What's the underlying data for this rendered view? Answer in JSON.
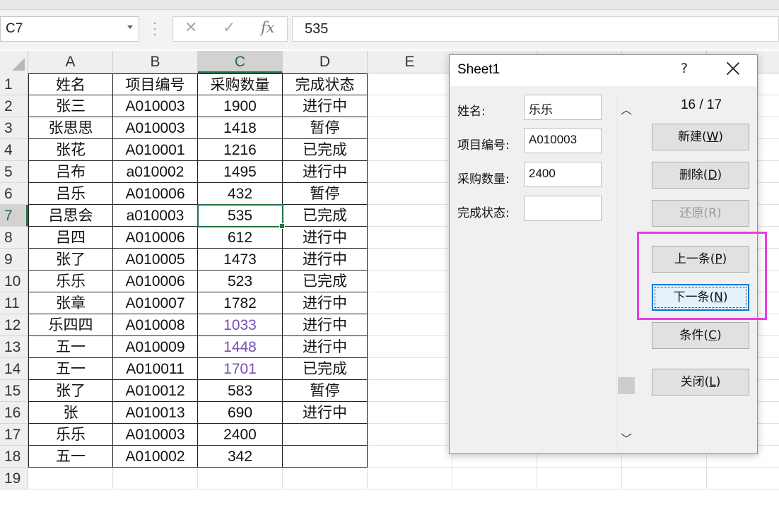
{
  "formula_bar": {
    "name_box": "C7",
    "formula_value": "535",
    "cancel_icon": "close-icon",
    "enter_icon": "check-icon",
    "function_label": "fx"
  },
  "columns": [
    "A",
    "B",
    "C",
    "D",
    "E"
  ],
  "row_numbers": [
    "1",
    "2",
    "3",
    "4",
    "5",
    "6",
    "7",
    "8",
    "9",
    "10",
    "11",
    "12",
    "13",
    "14",
    "15",
    "16",
    "17",
    "18",
    "19"
  ],
  "table": {
    "header": [
      "姓名",
      "项目编号",
      "采购数量",
      "完成状态"
    ],
    "rows": [
      [
        "张三",
        "A010003",
        "1900",
        "进行中"
      ],
      [
        "张思思",
        "A010003",
        "1418",
        "暂停"
      ],
      [
        "张花",
        "A010001",
        "1216",
        "已完成"
      ],
      [
        "吕布",
        "a010002",
        "1495",
        "进行中"
      ],
      [
        "吕乐",
        "A010006",
        "432",
        "暂停"
      ],
      [
        "吕思会",
        "a010003",
        "535",
        "已完成"
      ],
      [
        "吕四",
        "A010006",
        "612",
        "进行中"
      ],
      [
        "张了",
        "A010005",
        "1473",
        "进行中"
      ],
      [
        "乐乐",
        "A010006",
        "523",
        "已完成"
      ],
      [
        "张章",
        "A010007",
        "1782",
        "进行中"
      ],
      [
        "乐四四",
        "A010008",
        "1033",
        "进行中"
      ],
      [
        "五一",
        "A010009",
        "1448",
        "进行中"
      ],
      [
        "五一",
        "A010011",
        "1701",
        "已完成"
      ],
      [
        "张了",
        "A010012",
        "583",
        "暂停"
      ],
      [
        "张",
        "A010013",
        "690",
        "进行中"
      ],
      [
        "乐乐",
        "A010003",
        "2400",
        ""
      ],
      [
        "五一",
        "A010002",
        "342",
        ""
      ]
    ],
    "purple_text_color": "#7a4fb4",
    "active_cell": "C7"
  },
  "dialog": {
    "title": "Sheet1",
    "help": "?",
    "fields": [
      {
        "label": "姓名:",
        "value": "乐乐"
      },
      {
        "label": "项目编号:",
        "value": "A010003"
      },
      {
        "label": "采购数量:",
        "value": "2400"
      },
      {
        "label": "完成状态:",
        "value": ""
      }
    ],
    "record_counter": "16 / 17",
    "buttons": {
      "new": {
        "text": "新建(",
        "key": "W",
        "end": ")"
      },
      "delete": {
        "text": "删除(",
        "key": "D",
        "end": ")"
      },
      "restore": {
        "text": "还原(",
        "key": "R",
        "end": ")"
      },
      "prev": {
        "text": "上一条(",
        "key": "P",
        "end": ")"
      },
      "next": {
        "text": "下一条(",
        "key": "N",
        "end": ")"
      },
      "criteria": {
        "text": "条件(",
        "key": "C",
        "end": ")"
      },
      "close": {
        "text": "关闭(",
        "key": "L",
        "end": ")"
      }
    },
    "scroll_up_icon": "chevron-up-icon",
    "scroll_down_icon": "chevron-down-icon"
  },
  "highlight_color": "#e83de0",
  "accent_color": "#217346"
}
